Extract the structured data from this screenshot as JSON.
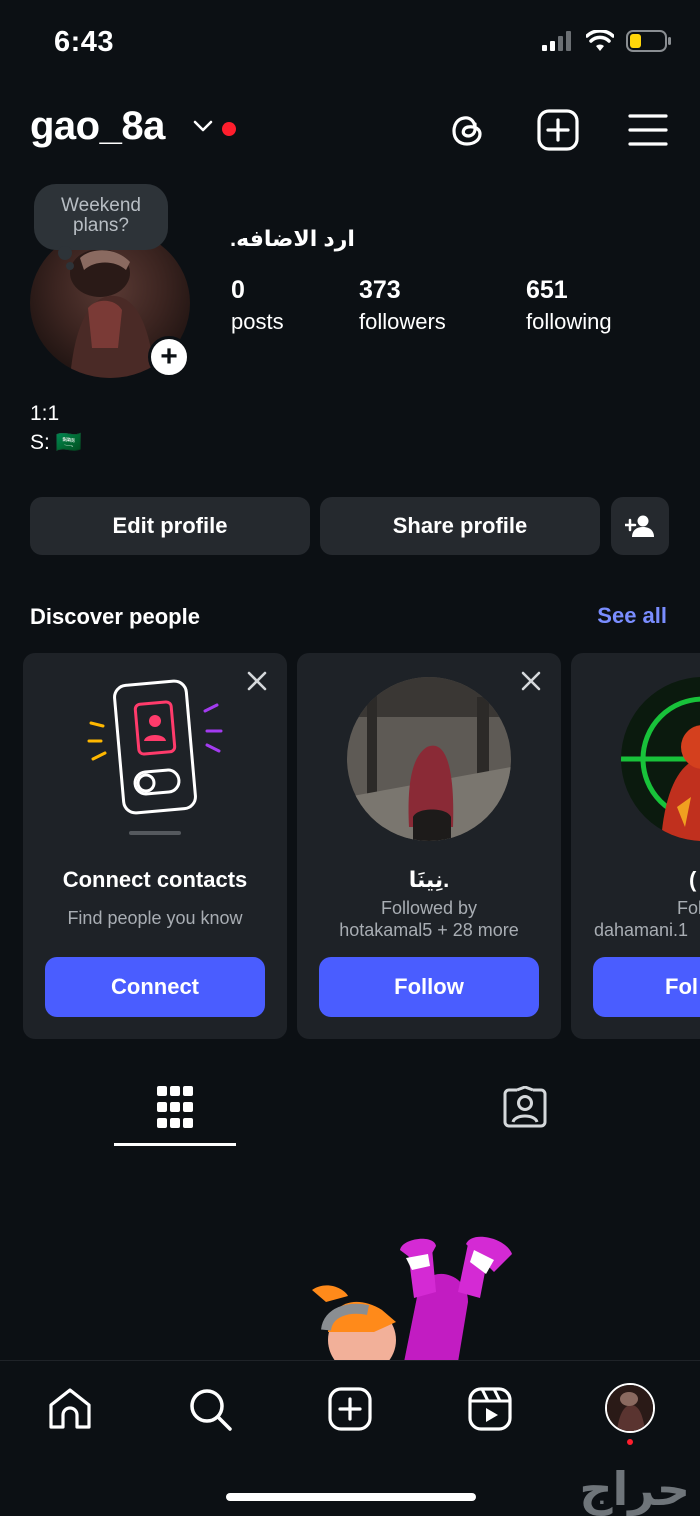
{
  "status_bar": {
    "time": "6:43"
  },
  "header": {
    "username": "gao_8a"
  },
  "profile": {
    "note": "Weekend plans?",
    "display_name": "ارد الاضافه.",
    "stats": [
      {
        "value": "0",
        "label": "posts"
      },
      {
        "value": "373",
        "label": "followers"
      },
      {
        "value": "651",
        "label": "following"
      }
    ],
    "bio_lines": [
      "1:1",
      "S: 🇸🇦"
    ],
    "edit_label": "Edit profile",
    "share_label": "Share profile"
  },
  "discover": {
    "title": "Discover people",
    "see_all": "See all",
    "contacts_card": {
      "title": "Connect contacts",
      "subtitle": "Find people you know",
      "button": "Connect"
    },
    "people": [
      {
        "name": "نِينَا.",
        "followed_by_1": "Followed by",
        "followed_by_2": "hotakamal5 + 28 more",
        "button": "Follow"
      },
      {
        "name": "(",
        "followed_by_1": "Follow",
        "followed_by_2": "dahamani.1",
        "button": "Fol"
      }
    ]
  },
  "watermark": "حراج",
  "colors": {
    "accent": "#4a5dff",
    "link": "#7a8dff",
    "background": "#0c1014",
    "live_dot": "#ff1e2d"
  },
  "icons": {
    "header": [
      "threads-icon",
      "add-post-icon",
      "menu-icon"
    ],
    "nav": [
      "home-icon",
      "search-icon",
      "create-icon",
      "reels-icon",
      "profile-avatar"
    ],
    "tabs": [
      "grid-icon",
      "tagged-icon"
    ]
  }
}
